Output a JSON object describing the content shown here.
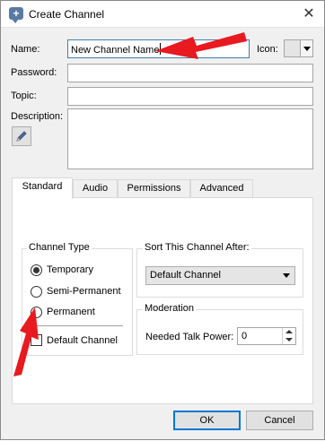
{
  "window": {
    "title": "Create Channel",
    "close_glyph": "✕",
    "app_icon_glyph": "+"
  },
  "form": {
    "name_label": "Name:",
    "name_value": "New Channel Name",
    "icon_label": "Icon:",
    "password_label": "Password:",
    "password_value": "",
    "topic_label": "Topic:",
    "topic_value": "",
    "description_label": "Description:",
    "description_value": "",
    "description_edit_icon": "pencil-icon"
  },
  "tabs": [
    {
      "label": "Standard",
      "active": true
    },
    {
      "label": "Audio",
      "active": false
    },
    {
      "label": "Permissions",
      "active": false
    },
    {
      "label": "Advanced",
      "active": false
    }
  ],
  "channel_type": {
    "title": "Channel Type",
    "options": [
      {
        "label": "Temporary",
        "checked": true
      },
      {
        "label": "Semi-Permanent",
        "checked": false
      },
      {
        "label": "Permanent",
        "checked": false
      }
    ],
    "default_channel_label": "Default Channel",
    "default_channel_checked": false
  },
  "sort": {
    "title": "Sort This Channel After:",
    "selected": "Default Channel"
  },
  "moderation": {
    "title": "Moderation",
    "needed_talk_power_label": "Needed Talk Power:",
    "needed_talk_power_value": "0"
  },
  "buttons": {
    "ok": "OK",
    "cancel": "Cancel"
  },
  "colors": {
    "annotation_arrow": "#e8191f",
    "focus_border": "#3c7fb1",
    "default_button_border": "#0078d7"
  }
}
